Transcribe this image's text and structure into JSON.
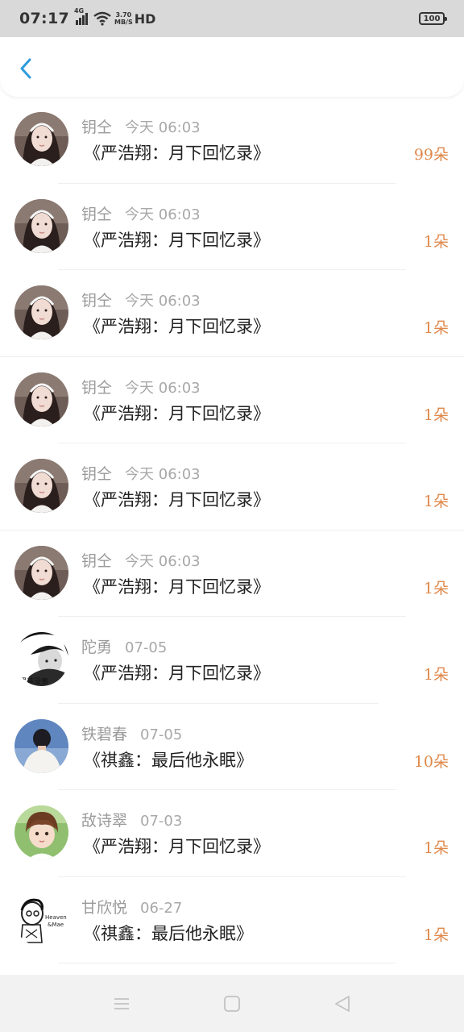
{
  "status_bar": {
    "time": "07:17",
    "network": "4G",
    "speed_value": "3.70",
    "speed_unit": "MB/S",
    "hd": "HD",
    "battery": "100"
  },
  "header": {
    "back_icon": "chevron-left-icon",
    "accent_color": "#2f9be0"
  },
  "rows": [
    {
      "name": "钥仝",
      "time": "今天 06:03",
      "title": "《严浩翔：月下回忆录》",
      "count": "99朵",
      "avatar": "girl-photo"
    },
    {
      "name": "钥仝",
      "time": "今天 06:03",
      "title": "《严浩翔：月下回忆录》",
      "count": "1朵",
      "avatar": "girl-photo"
    },
    {
      "name": "钥仝",
      "time": "今天 06:03",
      "title": "《严浩翔：月下回忆录》",
      "count": "1朵",
      "avatar": "girl-photo"
    },
    {
      "name": "钥仝",
      "time": "今天 06:03",
      "title": "《严浩翔：月下回忆录》",
      "count": "1朵",
      "avatar": "girl-photo"
    },
    {
      "name": "钥仝",
      "time": "今天 06:03",
      "title": "《严浩翔：月下回忆录》",
      "count": "1朵",
      "avatar": "girl-photo"
    },
    {
      "name": "钥仝",
      "time": "今天 06:03",
      "title": "《严浩翔：月下回忆录》",
      "count": "1朵",
      "avatar": "girl-photo"
    },
    {
      "name": "陀勇",
      "time": "07-05",
      "title": "《严浩翔：月下回忆录》",
      "count": "1朵",
      "avatar": "bw-portrait"
    },
    {
      "name": "铁碧春",
      "time": "07-05",
      "title": "《祺鑫：最后他永眠》",
      "count": "10朵",
      "avatar": "back-view"
    },
    {
      "name": "敌诗翠",
      "time": "07-03",
      "title": "《严浩翔：月下回忆录》",
      "count": "1朵",
      "avatar": "cartoon-boy"
    },
    {
      "name": "甘欣悦",
      "time": "06-27",
      "title": "《祺鑫：最后他永眠》",
      "count": "1朵",
      "avatar": "sketch"
    }
  ],
  "count_color": "#e0884a",
  "nav": {
    "menu_icon": "menu-icon",
    "home_icon": "home-square-icon",
    "back_icon": "back-triangle-icon"
  }
}
